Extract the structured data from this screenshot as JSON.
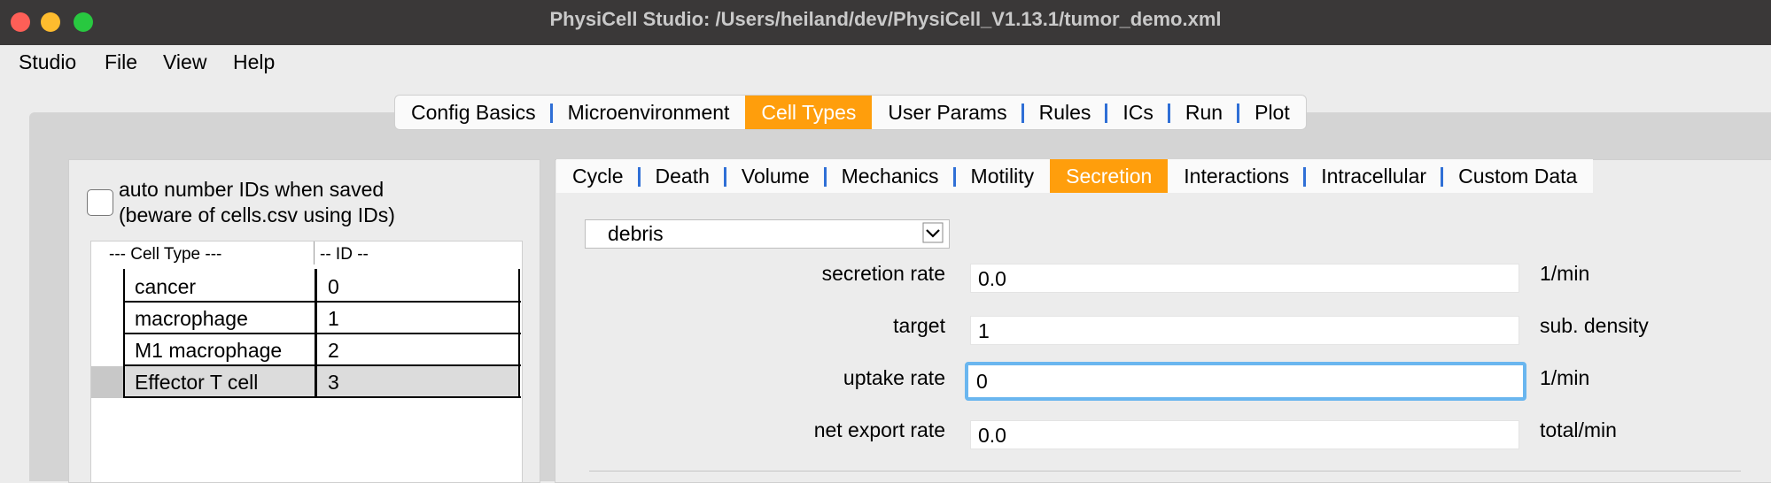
{
  "window": {
    "title": "PhysiCell Studio: /Users/heiland/dev/PhysiCell_V1.13.1/tumor_demo.xml",
    "traffic_lights": [
      "close",
      "minimize",
      "zoom"
    ]
  },
  "menubar": [
    "Studio",
    "File",
    "View",
    "Help"
  ],
  "main_tabs": {
    "items": [
      "Config Basics",
      "Microenvironment",
      "Cell Types",
      "User Params",
      "Rules",
      "ICs",
      "Run",
      "Plot"
    ],
    "active": "Cell Types"
  },
  "left_panel": {
    "checkbox": {
      "line1": "auto number IDs when saved",
      "line2": "(beware of cells.csv using IDs)",
      "checked": false
    },
    "table": {
      "headers": [
        "--- Cell Type ---",
        "-- ID --"
      ],
      "rows": [
        {
          "name": "cancer",
          "id": "0"
        },
        {
          "name": "macrophage",
          "id": "1"
        },
        {
          "name": "M1 macrophage",
          "id": "2"
        },
        {
          "name": "Effector T cell",
          "id": "3"
        }
      ],
      "selected_row": 3
    }
  },
  "sub_tabs": {
    "items": [
      "Cycle",
      "Death",
      "Volume",
      "Mechanics",
      "Motility",
      "Secretion",
      "Interactions",
      "Intracellular",
      "Custom Data"
    ],
    "active": "Secretion"
  },
  "secretion": {
    "substrate": "debris",
    "fields": [
      {
        "label": "secretion rate",
        "value": "0.0",
        "unit": "1/min"
      },
      {
        "label": "target",
        "value": "1",
        "unit": "sub. density"
      },
      {
        "label": "uptake rate",
        "value": "0",
        "unit": "1/min"
      },
      {
        "label": "net export rate",
        "value": "0.0",
        "unit": "total/min"
      }
    ]
  },
  "colors": {
    "active_tab": "#ff9e0c",
    "tab_separator": "#2f6fd6",
    "focus_ring": "#6ab6ef",
    "titlebar": "#3a3838"
  }
}
